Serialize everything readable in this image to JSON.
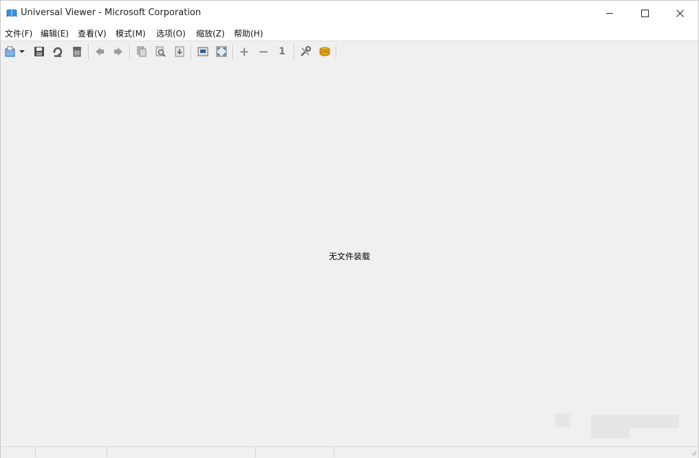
{
  "window": {
    "title": "Universal Viewer - Microsoft Corporation",
    "controls": {
      "minimize": "—",
      "maximize": "☐",
      "close": "✕"
    }
  },
  "menu": {
    "items": [
      {
        "label": "文件(F)"
      },
      {
        "label": "编辑(E)"
      },
      {
        "label": "查看(V)"
      },
      {
        "label": "模式(M)"
      },
      {
        "label": "选项(O)"
      },
      {
        "label": "缩放(Z)"
      },
      {
        "label": "帮助(H)"
      }
    ]
  },
  "toolbar": {
    "icons": [
      "open-icon",
      "dropdown-arrow-icon",
      "save-icon",
      "reload-icon",
      "close-file-icon",
      "back-icon",
      "forward-icon",
      "copy-icon",
      "find-icon",
      "goto-icon",
      "fit-window-icon",
      "fullscreen-icon",
      "zoom-in-icon",
      "zoom-out-icon",
      "original-size-icon",
      "settings-icon",
      "plugins-icon"
    ],
    "zoom_in": "+",
    "zoom_out": "−",
    "original_size": "1"
  },
  "main": {
    "empty_message": "无文件装载"
  },
  "colors": {
    "background": "#f0f0f0",
    "titlebar": "#ffffff",
    "accent_blue": "#2f7fd0",
    "plugin_orange": "#e0a020"
  }
}
